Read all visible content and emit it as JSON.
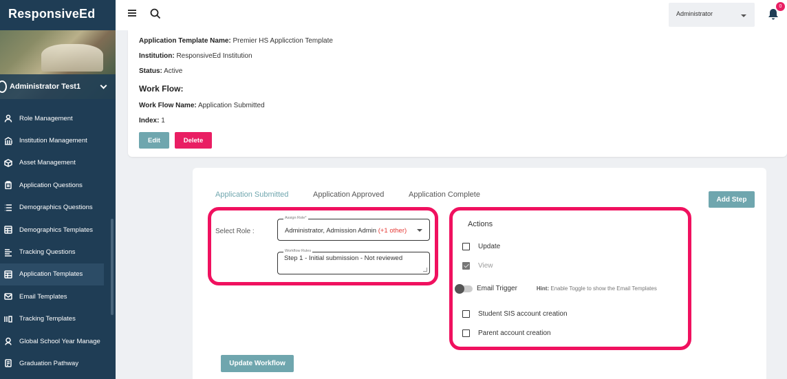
{
  "app": {
    "brand": "ResponsiveEd"
  },
  "sidebar": {
    "user_name": "Administrator Test1",
    "items": [
      {
        "label": "Role Management",
        "icon": "user-icon"
      },
      {
        "label": "Institution Management",
        "icon": "institution-icon"
      },
      {
        "label": "Asset Management",
        "icon": "box-icon"
      },
      {
        "label": "Application Questions",
        "icon": "clipboard-icon"
      },
      {
        "label": "Demographics Questions",
        "icon": "list-icon"
      },
      {
        "label": "Demographics Templates",
        "icon": "template-icon"
      },
      {
        "label": "Tracking Questions",
        "icon": "list-icon"
      },
      {
        "label": "Application Templates",
        "icon": "template-icon"
      },
      {
        "label": "Email Templates",
        "icon": "email-icon"
      },
      {
        "label": "Tracking Templates",
        "icon": "tracking-icon"
      },
      {
        "label": "Global School Year Manage",
        "icon": "globe-user-icon"
      },
      {
        "label": "Graduation Pathway",
        "icon": "document-icon"
      }
    ],
    "active_index": 7
  },
  "topbar": {
    "role": "Administrator",
    "notifications": "0"
  },
  "info": {
    "template_label": "Application Template Name:",
    "template_value": "Premier HS Applicction Template",
    "institution_label": "Institution:",
    "institution_value": "ResponsiveEd Institution",
    "status_label": "Status:",
    "status_value": "Active",
    "workflow_title": "Work Flow:",
    "workflow_name_label": "Work Flow Name:",
    "workflow_name_value": "Application Submitted",
    "index_label": "Index:",
    "index_value": "1",
    "edit_label": "Edit",
    "delete_label": "Delete"
  },
  "workflow": {
    "tabs": [
      "Application Submitted",
      "Application Approved",
      "Application Complete"
    ],
    "active_tab": 0,
    "add_step_label": "Add Step",
    "select_role_label": "Select Role :",
    "assign_role_legend": "Assign Role*",
    "assign_role_value": "Administrator, Admission Admin",
    "assign_role_more": "(+1 other)",
    "rules_legend": "Workflow Rules",
    "rules_value": "Step 1 - Initial submission - Not reviewed",
    "actions_title": "Actions",
    "update_label": "Update",
    "view_label": "View",
    "email_trigger_label": "Email Trigger",
    "hint_label": "Hint:",
    "hint_text": "Enable Toggle to show the Email Templates",
    "student_sis_label": "Student SIS account creation",
    "parent_account_label": "Parent account creation",
    "update_workflow_label": "Update Workflow"
  },
  "colors": {
    "sidebar": "#1f3d55",
    "accent": "#6fa6ae",
    "danger": "#e91e63",
    "highlight": "#f0115f"
  }
}
